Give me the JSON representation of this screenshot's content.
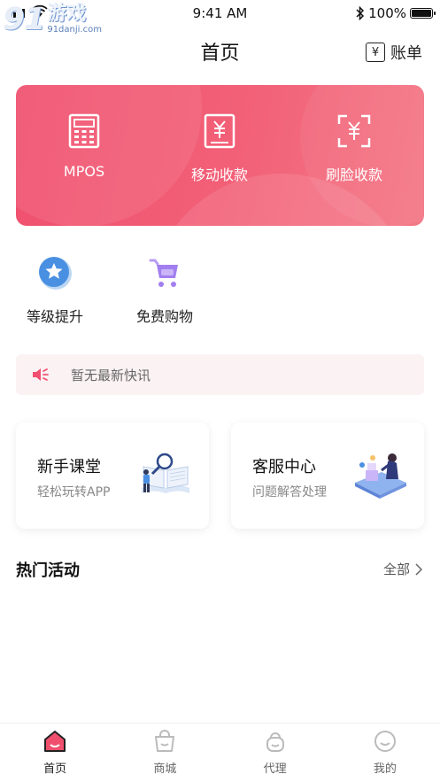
{
  "status_bar": {
    "time": "9:41 AM",
    "battery": "100%"
  },
  "watermark": {
    "number": "91",
    "brand": "游戏",
    "url": "91danji.com"
  },
  "nav": {
    "title": "首页",
    "bill_label": "账单",
    "bill_icon": "yen-receipt-icon"
  },
  "banner": {
    "items": [
      {
        "label": "MPOS",
        "icon": "calculator-icon"
      },
      {
        "label": "移动收款",
        "icon": "yen-receipt-icon"
      },
      {
        "label": "刷脸收款",
        "icon": "face-scan-yen-icon"
      }
    ]
  },
  "quick_entries": [
    {
      "label": "等级提升",
      "icon": "star-badge-icon"
    },
    {
      "label": "免费购物",
      "icon": "shopping-cart-icon"
    }
  ],
  "notice": {
    "text": "暂无最新快讯",
    "icon": "speaker-icon"
  },
  "cards": [
    {
      "title": "新手课堂",
      "subtitle": "轻松玩转APP"
    },
    {
      "title": "客服中心",
      "subtitle": "问题解答处理"
    }
  ],
  "section": {
    "title": "热门活动",
    "more": "全部"
  },
  "tabbar": [
    {
      "label": "首页",
      "icon": "home-icon"
    },
    {
      "label": "商城",
      "icon": "shopping-bag-icon"
    },
    {
      "label": "代理",
      "icon": "agent-icon"
    },
    {
      "label": "我的",
      "icon": "profile-icon"
    }
  ],
  "colors": {
    "accent": "#f0506e",
    "notice_bg": "#fbf2f4",
    "text_muted": "#888888"
  }
}
